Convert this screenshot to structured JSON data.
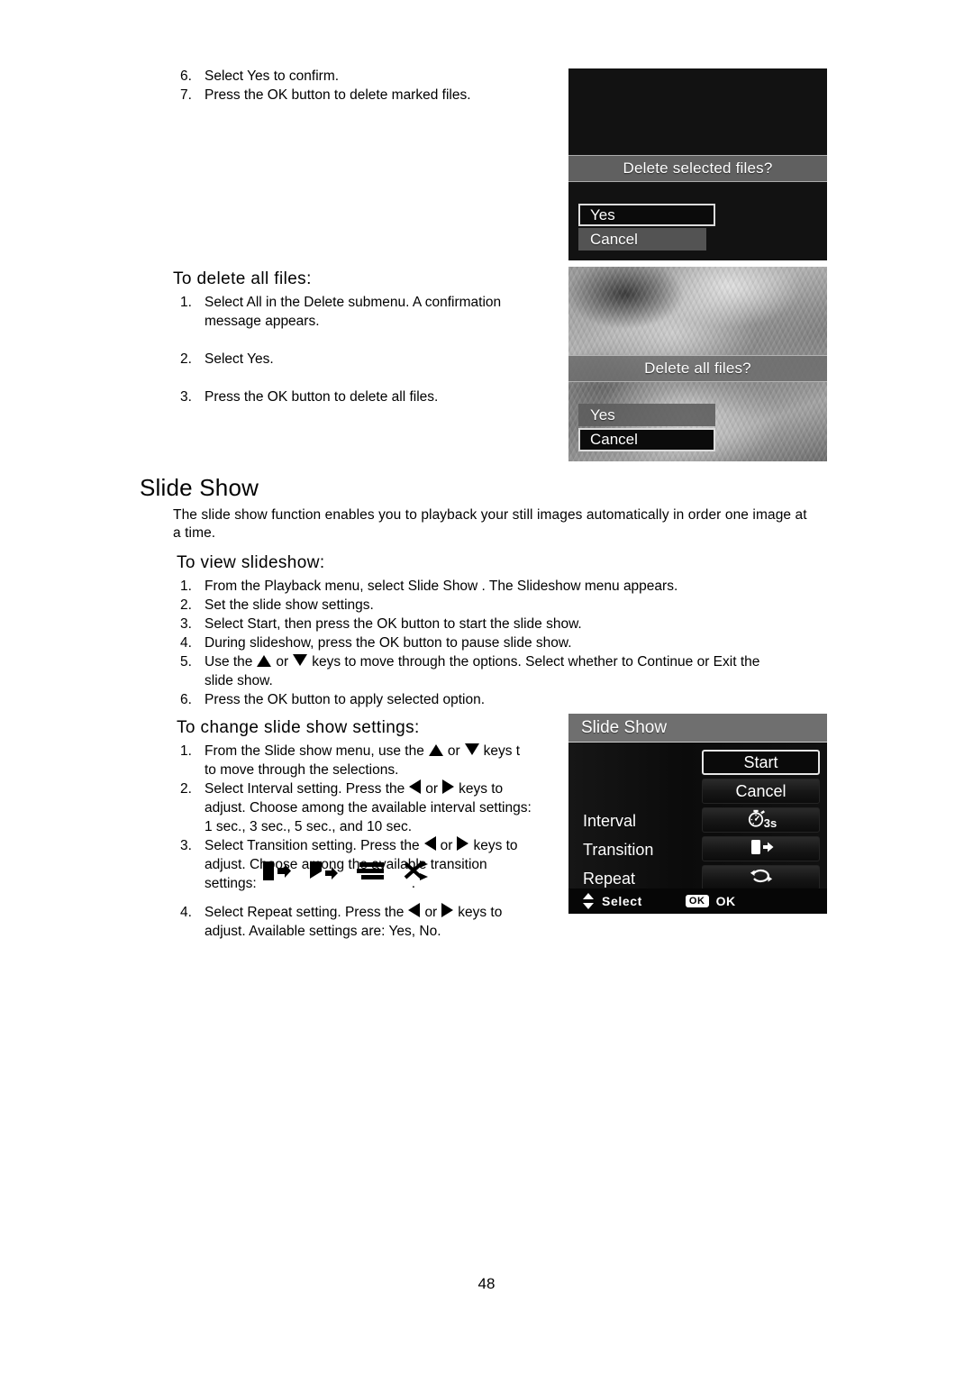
{
  "document": {
    "page_number": "48"
  },
  "delete_marked_steps": [
    {
      "num": "6.",
      "text": "Select Yes to confirm."
    },
    {
      "num": "7.",
      "text": "Press the OK button to delete marked files."
    }
  ],
  "delete_all_section": {
    "heading": "To delete all files:",
    "steps": [
      {
        "num": "1.",
        "line1": "Select All in the Delete submenu. A confirmation",
        "line2": "message appears."
      },
      {
        "num": "2.",
        "line1": "Select Yes."
      },
      {
        "num": "3.",
        "line1": "Press the OK button to delete all files."
      }
    ]
  },
  "slide_show_section": {
    "heading": "Slide Show",
    "intro_line1": "The slide show function enables you to playback your still images automatically in order one image at",
    "intro_line2": "a time.",
    "view_heading": "To view slideshow:",
    "view_steps": [
      {
        "num": "1.",
        "text": "From the Playback menu, select Slide Show . The Slideshow menu appears."
      },
      {
        "num": "2.",
        "text": "Set the slide show settings."
      },
      {
        "num": "3.",
        "text": "Select Start, then press the OK button to start the slide show."
      },
      {
        "num": "4.",
        "text": "During slideshow, press the OK button to pause slide show."
      },
      {
        "num": "5.",
        "pre": "Use the",
        "mid": "or",
        "post": "keys to move through the options. Select whether to Continue or Exit the",
        "line2": "slide show."
      },
      {
        "num": "6.",
        "text": "Press the OK button to apply selected option."
      }
    ],
    "change_heading": "To change slide show settings:",
    "change_steps": {
      "s1": {
        "num": "1.",
        "pre": "From the Slide show menu, use the",
        "mid": "or",
        "post": "keys t",
        "line2": "to move through the selections."
      },
      "s2": {
        "num": "2.",
        "pre": "Select Interval setting. Press the",
        "mid": "or",
        "post": "keys to",
        "line2": "adjust. Choose among the available interval settings:",
        "line3": "1 sec., 3 sec., 5 sec., and 10 sec."
      },
      "s3": {
        "num": "3.",
        "pre": "Select Transition setting. Press the",
        "mid": "or",
        "post": "keys to",
        "line2": "adjust. Choose among the available transition",
        "line3_label": "settings:",
        "line3_tail": "."
      },
      "s4": {
        "num": "4.",
        "pre": "Select Repeat setting. Press the",
        "mid": "or",
        "post": "keys to",
        "line2": "adjust. Available settings are: Yes, No."
      }
    },
    "transition_icon_names": [
      "slide-transition-icon",
      "diagonal-wipe-transition-icon",
      "blinds-transition-icon",
      "random-transition-icon"
    ]
  },
  "screens": {
    "delete_selected": {
      "banner": "Delete selected files?",
      "options": [
        {
          "label": "Yes",
          "state": "selected"
        },
        {
          "label": "Cancel",
          "state": "unselected"
        }
      ]
    },
    "delete_all": {
      "banner": "Delete all files?",
      "options": [
        {
          "label": "Yes",
          "state": "unselected"
        },
        {
          "label": "Cancel",
          "state": "selected"
        }
      ]
    },
    "slide_show_menu": {
      "title": "Slide Show",
      "rows": [
        {
          "label": "",
          "value": "Start",
          "state": "selected",
          "icon": ""
        },
        {
          "label": "",
          "value": "Cancel",
          "state": "normal",
          "icon": ""
        },
        {
          "label": "Interval",
          "value": "3s",
          "state": "normal",
          "icon": "stopwatch-icon"
        },
        {
          "label": "Transition",
          "value": "",
          "state": "normal",
          "icon": "slide-transition-icon"
        },
        {
          "label": "Repeat",
          "value": "",
          "state": "normal",
          "icon": "loop-icon"
        }
      ],
      "footer": {
        "select_label": "Select",
        "ok_badge": "OK",
        "ok_label": "OK"
      }
    }
  },
  "colors": {
    "lcd_background": "#121212",
    "banner_gray": "#6e6e6e",
    "highlight_border": "#dcdcdc",
    "text_white": "#ffffff"
  }
}
